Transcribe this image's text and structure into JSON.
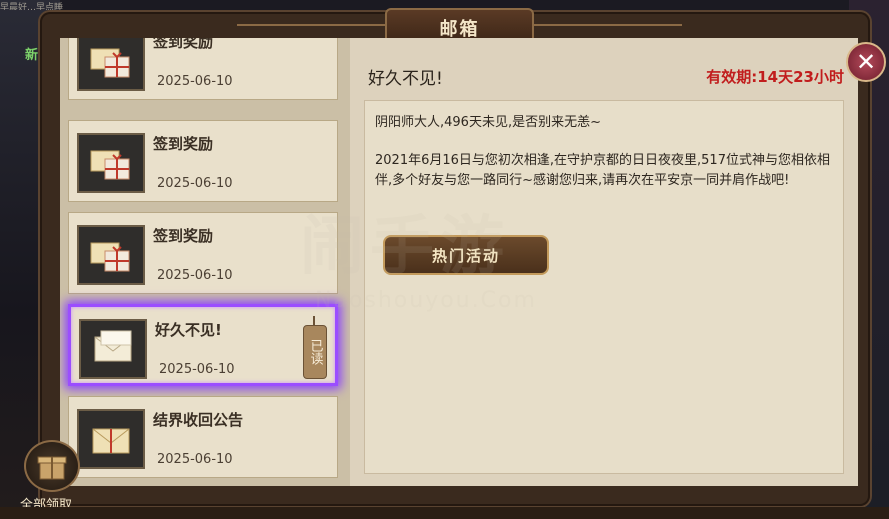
{
  "window": {
    "title": "邮箱",
    "new_badge": "新",
    "top_hint": "早晨好…早点睡"
  },
  "mail_list": {
    "items": [
      {
        "title": "签到奖励",
        "date": "2025-06-10",
        "icon": "reward-package-icon"
      },
      {
        "title": "签到奖励",
        "date": "2025-06-10",
        "icon": "reward-package-icon"
      },
      {
        "title": "签到奖励",
        "date": "2025-06-10",
        "icon": "reward-package-icon"
      },
      {
        "title": "好久不见!",
        "date": "2025-06-10",
        "icon": "letter-icon",
        "selected": true,
        "read_tag": "已读"
      },
      {
        "title": "结界收回公告",
        "date": "2025-06-10",
        "icon": "letter-icon"
      }
    ]
  },
  "detail": {
    "subject": "好久不见!",
    "validity": "有效期:14天23小时",
    "body": [
      "阴阳师大人,496天未见,是否别来无恙~",
      "2021年6月16日与您初次相逢,在守护京都的日日夜夜里,517位式神与您相依相伴,多个好友与您一路同行~感谢您归来,请再次在平安京一同并肩作战吧!"
    ],
    "action_button": "热门活动"
  },
  "footer": {
    "collect_all": "全部领取"
  },
  "watermark": {
    "main": "闹手游",
    "sub": "Naoshouyou.Com"
  },
  "colors": {
    "validity": "#c11d1d",
    "selection_glow": "#9b4dff"
  }
}
